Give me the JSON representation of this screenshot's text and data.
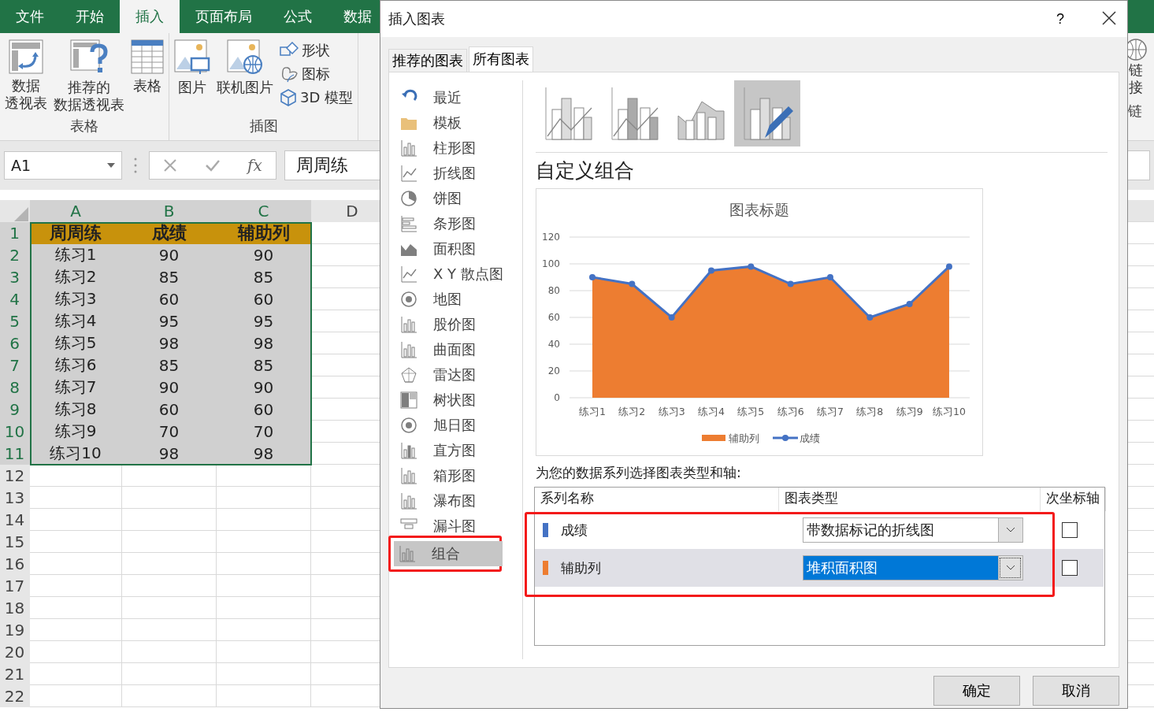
{
  "ribbon_tabs": [
    {
      "label": "文件",
      "selected": false
    },
    {
      "label": "开始",
      "selected": false
    },
    {
      "label": "插入",
      "selected": true
    },
    {
      "label": "页面布局",
      "selected": false
    },
    {
      "label": "公式",
      "selected": false
    },
    {
      "label": "数据",
      "selected": false
    }
  ],
  "ribbon_groups": [
    {
      "label": "表格",
      "items": [
        {
          "lines": [
            "数据",
            "透视表"
          ],
          "kind": "large"
        },
        {
          "lines": [
            "推荐的",
            "数据透视表"
          ],
          "kind": "large"
        },
        {
          "lines": [
            "表格"
          ],
          "kind": "large"
        }
      ]
    },
    {
      "label": "插图",
      "items": [
        {
          "lines": [
            "图片"
          ],
          "kind": "large"
        },
        {
          "lines": [
            "联机图片"
          ],
          "kind": "large"
        },
        {
          "lines": [
            "形状"
          ],
          "kind": "small"
        },
        {
          "lines": [
            "图标"
          ],
          "kind": "small"
        },
        {
          "lines": [
            "3D 模型"
          ],
          "kind": "small"
        }
      ]
    }
  ],
  "edge_group": {
    "label": "链",
    "button": "链接"
  },
  "name_box": "A1",
  "function_label": "fx",
  "formula": "周周练",
  "sheet": {
    "columns": [
      {
        "label": "A",
        "selected": true
      },
      {
        "label": "B",
        "selected": true
      },
      {
        "label": "C",
        "selected": true
      },
      {
        "label": "D",
        "selected": false
      }
    ],
    "rows": [
      {
        "number": "1",
        "kind": "header",
        "selected": true,
        "cells": [
          "周周练",
          "成绩",
          "辅助列"
        ]
      },
      {
        "number": "2",
        "kind": "data",
        "selected": true,
        "cells": [
          "练习1",
          "90",
          "90"
        ]
      },
      {
        "number": "3",
        "kind": "data",
        "selected": true,
        "cells": [
          "练习2",
          "85",
          "85"
        ]
      },
      {
        "number": "4",
        "kind": "data",
        "selected": true,
        "cells": [
          "练习3",
          "60",
          "60"
        ]
      },
      {
        "number": "5",
        "kind": "data",
        "selected": true,
        "cells": [
          "练习4",
          "95",
          "95"
        ]
      },
      {
        "number": "6",
        "kind": "data",
        "selected": true,
        "cells": [
          "练习5",
          "98",
          "98"
        ]
      },
      {
        "number": "7",
        "kind": "data",
        "selected": true,
        "cells": [
          "练习6",
          "85",
          "85"
        ]
      },
      {
        "number": "8",
        "kind": "data",
        "selected": true,
        "cells": [
          "练习7",
          "90",
          "90"
        ]
      },
      {
        "number": "9",
        "kind": "data",
        "selected": true,
        "cells": [
          "练习8",
          "60",
          "60"
        ]
      },
      {
        "number": "10",
        "kind": "data",
        "selected": true,
        "cells": [
          "练习9",
          "70",
          "70"
        ]
      },
      {
        "number": "11",
        "kind": "data",
        "selected": true,
        "cells": [
          "练习10",
          "98",
          "98"
        ]
      },
      {
        "number": "12",
        "selected": false
      },
      {
        "number": "13",
        "selected": false
      },
      {
        "number": "14",
        "selected": false
      },
      {
        "number": "15",
        "selected": false
      },
      {
        "number": "16",
        "selected": false
      },
      {
        "number": "17",
        "selected": false
      },
      {
        "number": "18",
        "selected": false
      },
      {
        "number": "19",
        "selected": false
      },
      {
        "number": "20",
        "selected": false
      },
      {
        "number": "21",
        "selected": false
      },
      {
        "number": "22",
        "selected": false
      }
    ]
  },
  "dialog": {
    "title": "插入图表",
    "help": "?",
    "tabs": [
      {
        "label": "推荐的图表",
        "selected": false
      },
      {
        "label": "所有图表",
        "selected": true
      }
    ],
    "chart_types": [
      {
        "label": "最近",
        "selected": false,
        "marked": false
      },
      {
        "label": "模板",
        "selected": false,
        "marked": false
      },
      {
        "label": "柱形图",
        "selected": false,
        "marked": false
      },
      {
        "label": "折线图",
        "selected": false,
        "marked": false
      },
      {
        "label": "饼图",
        "selected": false,
        "marked": false
      },
      {
        "label": "条形图",
        "selected": false,
        "marked": false
      },
      {
        "label": "面积图",
        "selected": false,
        "marked": false
      },
      {
        "label": "X Y 散点图",
        "selected": false,
        "marked": false
      },
      {
        "label": "地图",
        "selected": false,
        "marked": false
      },
      {
        "label": "股价图",
        "selected": false,
        "marked": false
      },
      {
        "label": "曲面图",
        "selected": false,
        "marked": false
      },
      {
        "label": "雷达图",
        "selected": false,
        "marked": false
      },
      {
        "label": "树状图",
        "selected": false,
        "marked": false
      },
      {
        "label": "旭日图",
        "selected": false,
        "marked": false
      },
      {
        "label": "直方图",
        "selected": false,
        "marked": false
      },
      {
        "label": "箱形图",
        "selected": false,
        "marked": false
      },
      {
        "label": "瀑布图",
        "selected": false,
        "marked": false
      },
      {
        "label": "漏斗图",
        "selected": false,
        "marked": false
      },
      {
        "label": "组合",
        "selected": true,
        "marked": true
      }
    ],
    "subtypes": [
      {
        "selected": false
      },
      {
        "selected": false
      },
      {
        "selected": false
      },
      {
        "selected": true
      }
    ],
    "subtype_title": "自定义组合",
    "preview": {
      "chart_data": {
        "type": "area",
        "title": "图表标题",
        "categories": [
          "练习1",
          "练习2",
          "练习3",
          "练习4",
          "练习5",
          "练习6",
          "练习7",
          "练习8",
          "练习9",
          "练习10"
        ],
        "ylim": [
          0,
          120
        ],
        "yticks": [
          0,
          20,
          40,
          60,
          80,
          100,
          120
        ],
        "grid": true,
        "legend": "bottom",
        "series": [
          {
            "name": "辅助列",
            "type": "area",
            "color": "#ed7d31",
            "values": [
              90,
              85,
              60,
              95,
              98,
              85,
              90,
              60,
              70,
              98
            ]
          },
          {
            "name": "成绩",
            "type": "line",
            "marker": "circle",
            "color": "#4472c4",
            "values": [
              90,
              85,
              60,
              95,
              98,
              85,
              90,
              60,
              70,
              98
            ]
          }
        ]
      }
    },
    "series_prompt": "为您的数据系列选择图表类型和轴:",
    "series_table": {
      "columns": [
        "系列名称",
        "图表类型",
        "次坐标轴"
      ],
      "marked": true,
      "rows": [
        {
          "name": "成绩",
          "color": "#4472c4",
          "chart_type": "带数据标记的折线图",
          "secondary_axis": false,
          "selected": false
        },
        {
          "name": "辅助列",
          "color": "#ed7d31",
          "chart_type": "堆积面积图",
          "secondary_axis": false,
          "selected": true
        }
      ]
    },
    "buttons": [
      "确定",
      "取消"
    ]
  }
}
